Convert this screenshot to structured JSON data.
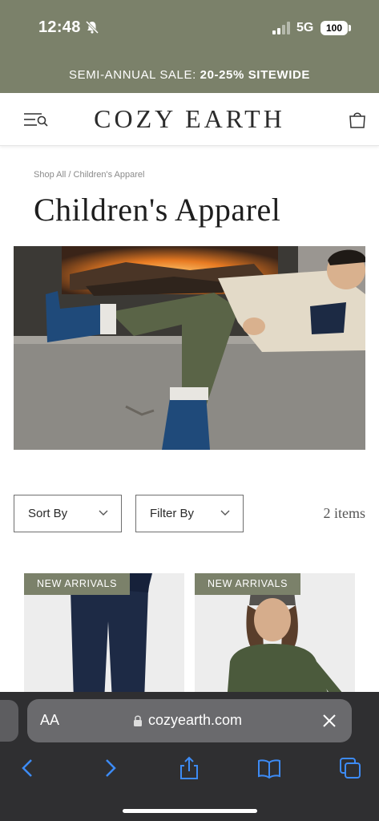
{
  "status_bar": {
    "time": "12:48",
    "network": "5G",
    "battery": "100"
  },
  "promo": {
    "prefix": "SEMI-ANNUAL SALE: ",
    "highlight": "20-25% SITEWIDE"
  },
  "header": {
    "logo": "COZY EARTH"
  },
  "breadcrumb": "Shop All / Children's Apparel",
  "page_title": "Children's Apparel",
  "controls": {
    "sort_label": "Sort By",
    "filter_label": "Filter By",
    "item_count": "2 items"
  },
  "products": [
    {
      "badge": "NEW ARRIVALS"
    },
    {
      "badge": "NEW ARRIVALS"
    }
  ],
  "browser": {
    "text_size_label": "AA",
    "url": "cozyearth.com"
  },
  "colors": {
    "brand_olive": "#7b816a",
    "browser_bg": "#2f2f31",
    "ios_blue": "#3d8bf5"
  },
  "icons": [
    "bell-slash-icon",
    "signal-icon",
    "menu-search-icon",
    "cart-icon",
    "chevron-down-icon",
    "lock-icon",
    "close-icon",
    "back-icon",
    "forward-icon",
    "share-icon",
    "bookmarks-icon",
    "tabs-icon"
  ]
}
